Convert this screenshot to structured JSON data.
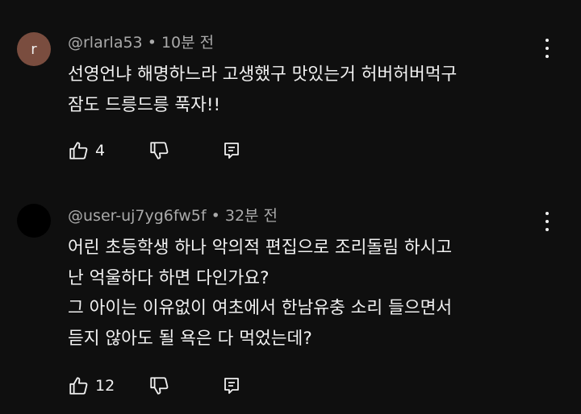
{
  "comments": [
    {
      "avatar_letter": "r",
      "avatar_color": "#7a4d3f",
      "username": "@rlarla53",
      "separator": " • ",
      "time": "10분 전",
      "lines": [
        "선영언냐 해명하느라 고생했구 맛있는거 허버허버먹구",
        "잠도 드릉드릉 푹자!!"
      ],
      "likes": "4"
    },
    {
      "avatar_letter": "",
      "avatar_color": "#000000",
      "username": "@user-uj7yg6fw5f",
      "separator": " • ",
      "time": "32분 전",
      "lines": [
        "어린 초등학생 하나 악의적 편집으로 조리돌림 하시고",
        "난 억울하다 하면 다인가요?",
        "그 아이는 이유없이 여초에서 한남유충 소리 들으면서",
        "듣지 않아도 될 욕은 다 먹었는데?"
      ],
      "likes": "12"
    }
  ],
  "icons": {
    "like": "thumbs-up-icon",
    "dislike": "thumbs-down-icon",
    "reply": "reply-icon",
    "more": "more-vert-icon"
  }
}
